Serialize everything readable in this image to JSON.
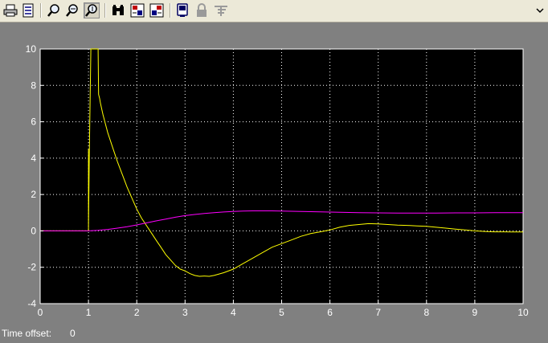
{
  "window": {
    "title": ""
  },
  "toolbar": {
    "buttons": [
      {
        "icon": "print-icon",
        "name": "print-button"
      },
      {
        "icon": "parameters-icon",
        "name": "parameters-button"
      },
      {
        "icon": "zoom-in-icon",
        "name": "zoom-button"
      },
      {
        "icon": "zoom-x-icon",
        "name": "zoom-x-button"
      },
      {
        "icon": "zoom-y-icon",
        "name": "zoom-y-button",
        "pressed": true
      },
      {
        "icon": "binoculars-icon",
        "name": "autoscale-button"
      },
      {
        "icon": "save-axes-icon",
        "name": "save-axes-button"
      },
      {
        "icon": "restore-axes-icon",
        "name": "restore-axes-button"
      },
      {
        "icon": "floating-scope-icon",
        "name": "floating-scope-button"
      },
      {
        "icon": "lock-icon",
        "name": "lock-axes-button",
        "disabled": true
      },
      {
        "icon": "signal-selector-icon",
        "name": "signal-selector-button",
        "disabled": true
      }
    ],
    "overflow_icon": "chevron-down-icon"
  },
  "status": {
    "label": "Time offset:",
    "value": "0"
  },
  "chart_data": {
    "type": "line",
    "title": "",
    "xlabel": "",
    "ylabel": "",
    "xlim": [
      0,
      10
    ],
    "ylim": [
      -4,
      10
    ],
    "x_ticks": [
      "0",
      "1",
      "2",
      "3",
      "4",
      "5",
      "6",
      "7",
      "8",
      "9",
      "10"
    ],
    "y_ticks": [
      "-4",
      "-2",
      "0",
      "2",
      "4",
      "6",
      "8",
      "10"
    ],
    "grid": true,
    "colors": {
      "background": "#000000",
      "grid": "#ffffff",
      "axis_text": "#ffffff"
    },
    "series": [
      {
        "color": "#ffff00",
        "x": [
          0,
          1.0,
          1.0,
          1.0,
          1.02,
          1.05,
          1.06,
          1.08,
          1.18,
          1.2,
          1.21,
          1.23,
          1.25,
          1.3,
          1.4,
          1.5,
          1.6,
          1.7,
          1.8,
          1.9,
          2.0,
          2.1,
          2.2,
          2.3,
          2.4,
          2.5,
          2.6,
          2.7,
          2.8,
          2.9,
          3.0,
          3.1,
          3.2,
          3.3,
          3.4,
          3.5,
          3.6,
          3.8,
          4.0,
          4.2,
          4.4,
          4.6,
          4.8,
          5.0,
          5.2,
          5.4,
          5.6,
          5.8,
          6.0,
          6.2,
          6.4,
          6.6,
          6.8,
          7.0,
          7.2,
          7.4,
          7.6,
          7.8,
          8.0,
          8.2,
          8.4,
          8.6,
          8.8,
          9.0,
          9.2,
          9.4,
          9.6,
          9.8,
          10.0
        ],
        "y": [
          0,
          0,
          4.5,
          0.2,
          4.7,
          10.0,
          10.0,
          10.0,
          10.0,
          10.0,
          7.5,
          7.3,
          7.0,
          6.4,
          5.4,
          4.6,
          3.8,
          3.1,
          2.4,
          1.8,
          1.2,
          0.7,
          0.3,
          -0.1,
          -0.5,
          -0.9,
          -1.3,
          -1.6,
          -1.9,
          -2.1,
          -2.2,
          -2.35,
          -2.45,
          -2.5,
          -2.48,
          -2.5,
          -2.45,
          -2.3,
          -2.1,
          -1.8,
          -1.5,
          -1.2,
          -0.9,
          -0.7,
          -0.5,
          -0.3,
          -0.15,
          -0.05,
          0.05,
          0.2,
          0.3,
          0.35,
          0.4,
          0.38,
          0.35,
          0.32,
          0.3,
          0.27,
          0.25,
          0.2,
          0.15,
          0.1,
          0.05,
          0.0,
          -0.03,
          -0.05,
          -0.05,
          -0.06,
          -0.06
        ]
      },
      {
        "color": "#ff00ff",
        "x": [
          0,
          1.0,
          1.2,
          1.4,
          1.6,
          1.8,
          2.0,
          2.2,
          2.4,
          2.6,
          2.8,
          3.0,
          3.2,
          3.4,
          3.6,
          3.8,
          4.0,
          4.2,
          4.4,
          4.6,
          4.8,
          5.0,
          5.4,
          5.8,
          6.2,
          6.6,
          7.0,
          7.4,
          7.8,
          8.2,
          8.6,
          9.0,
          9.4,
          9.8,
          10.0
        ],
        "y": [
          0,
          0,
          0.03,
          0.08,
          0.15,
          0.23,
          0.33,
          0.44,
          0.55,
          0.65,
          0.75,
          0.84,
          0.9,
          0.96,
          1.0,
          1.04,
          1.07,
          1.09,
          1.1,
          1.1,
          1.1,
          1.09,
          1.07,
          1.05,
          1.02,
          1.0,
          0.99,
          0.98,
          0.98,
          0.98,
          0.99,
          0.99,
          1.0,
          1.0,
          1.0
        ]
      }
    ]
  }
}
